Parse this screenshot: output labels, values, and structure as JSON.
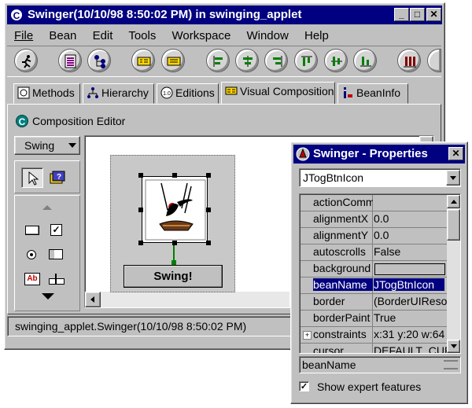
{
  "main_window": {
    "title": "Swinger(10/10/98 8:50:02 PM) in swinging_applet",
    "menu": [
      "File",
      "Bean",
      "Edit",
      "Tools",
      "Workspace",
      "Window",
      "Help"
    ],
    "toolbar_icons": [
      "run-icon",
      "method-list-icon",
      "hierarchy-icon",
      "beans-list-icon",
      "beans-list-2-icon",
      "align-left-icon",
      "align-center-icon",
      "align-right-icon",
      "align-top-icon",
      "align-middle-icon",
      "align-bottom-icon",
      "distribute-icon"
    ],
    "tabs": [
      "Methods",
      "Hierarchy",
      "Editions",
      "Visual Composition",
      "BeanInfo"
    ],
    "editor_title": "Composition Editor",
    "palette_category": "Swing",
    "swing_button_label": "Swing!",
    "status_text": "swinging_applet.Swinger(10/10/98 8:50:02 PM)"
  },
  "properties_window": {
    "title": "Swinger - Properties",
    "selected_bean": "JTogBtnIcon",
    "rows": [
      {
        "name": "actionComm",
        "value": ""
      },
      {
        "name": "alignmentX",
        "value": "0.0"
      },
      {
        "name": "alignmentY",
        "value": "0.0"
      },
      {
        "name": "autoscrolls",
        "value": "False"
      },
      {
        "name": "background",
        "value": ""
      },
      {
        "name": "beanName",
        "value": "JTogBtnIcon"
      },
      {
        "name": "border",
        "value": "(BorderUIResource"
      },
      {
        "name": "borderPaint",
        "value": "True"
      },
      {
        "name": "constraints",
        "value": "x:31 y:20 w:64"
      },
      {
        "name": "cursor",
        "value": "DEFAULT_CURSOR"
      }
    ],
    "description_field": "beanName",
    "expert_checkbox_label": "Show expert features",
    "expert_checked": true
  },
  "colors": {
    "title_active": "#000080",
    "title_inactive": "#808080",
    "face": "#c0c0c0",
    "selection": "#000080"
  }
}
